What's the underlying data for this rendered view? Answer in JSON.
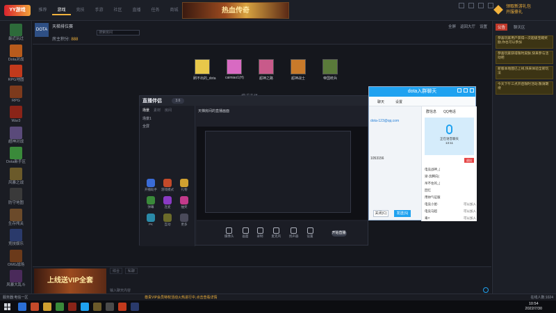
{
  "topbar": {
    "logo": "YY游戏",
    "tabs": [
      "推荐",
      "游戏",
      "竞技",
      "手游",
      "社区",
      "直播",
      "任务",
      "商城"
    ],
    "active_tab": 1,
    "banner_text": "热血传奇",
    "gold_text_1": "领取新游礼包",
    "gold_text_2": "开服豪礼"
  },
  "sidebar": {
    "items": [
      {
        "label": "最近玩过",
        "color": "#2d6b3a"
      },
      {
        "label": "Dota对战",
        "color": "#b85b1c"
      },
      {
        "label": "RPG地图",
        "color": "#c23a1c"
      },
      {
        "label": "RPG",
        "color": "#7d3a1c"
      },
      {
        "label": "War3",
        "color": "#8a2418"
      },
      {
        "label": "超神对战",
        "color": "#5a4a7a"
      },
      {
        "label": "Dota新手区",
        "color": "#3a8a3a"
      },
      {
        "label": "风暴之战",
        "color": "#6b5a2a"
      },
      {
        "label": "防守地图",
        "color": "#3a3a3a"
      },
      {
        "label": "生存闯关",
        "color": "#6b4a2a"
      },
      {
        "label": "竞技娱乐",
        "color": "#2a3a6b"
      },
      {
        "label": "OMG战场",
        "color": "#6b3a1a"
      },
      {
        "label": "风暴大乱斗",
        "color": "#4a2a5a"
      }
    ]
  },
  "room": {
    "icon_label": "DOTA",
    "title": "天梯排位赛",
    "search_placeholder": "搜索房间",
    "owner_label": "房主积分:",
    "owner_value": "888",
    "buttons": [
      "全屏",
      "返回大厅",
      "设置"
    ]
  },
  "games": [
    {
      "label": "刷不出的_dota",
      "color": "#e8c84a"
    },
    {
      "label": "caimiao1(H)",
      "color": "#d86ac2"
    },
    {
      "label": "超神之路",
      "color": "#c85a8a"
    },
    {
      "label": "超神战士",
      "color": "#c87a2a"
    },
    {
      "label": "帝国统兵",
      "color": "#5a7a3a"
    }
  ],
  "mode_text": "模式选择",
  "livewin": {
    "logo": "直播伴侣",
    "version": "3.6",
    "tabs": [
      "场景",
      "素材",
      "房间"
    ],
    "scenes": [
      "场景1",
      "全屏"
    ],
    "preview_title": "天梯房间的直播画面",
    "tools": [
      "开播助手",
      "游戏模式",
      "礼物",
      "弹幕",
      "连麦",
      "抽奖",
      "PK",
      "互动",
      "更多"
    ],
    "bottom_buttons": [
      "摄像头",
      "画面",
      "录制",
      "麦克风",
      "扬声器",
      "设置"
    ],
    "start_label": "开始直播"
  },
  "qq": {
    "title": "dota入群聊天",
    "sub_tabs": [
      "聊天",
      "设置"
    ],
    "link": "dota-123@qq.com",
    "number": "1053156",
    "close_label": "关闭(C)",
    "send_label": "发送(S)",
    "right_tabs": [
      "群信息",
      "QQ电话"
    ],
    "voice_label": "正在语音聊天",
    "voice_time": "13:11",
    "exit_label": "退出",
    "members": [
      {
        "name": "电竞战神_(",
        "status": ""
      },
      {
        "name": "梁-奔腾向(",
        "status": ""
      },
      {
        "name": "吊不住的_(",
        "status": ""
      },
      {
        "name": "回忆",
        "status": ""
      },
      {
        "name": "用帅气征服",
        "status": ""
      },
      {
        "name": "电竞小屋-",
        "status": "可以加入"
      },
      {
        "name": "电竞马超",
        "status": "可以加入"
      },
      {
        "name": "毒Y",
        "status": "可以加入"
      }
    ]
  },
  "rpanel": {
    "tabs": [
      "公告",
      "聊天区"
    ],
    "active_tab": 0,
    "notices": [
      "恭喜玩家用户获得一次超级宝箱奖励,你也可以参加",
      "恭喜玩家获得限时皮肤,快来参与活动吧",
      "新版本地图已上线,快来体验全新玩法",
      "今天下午三点开启限时活动,敬请期待"
    ]
  },
  "bottom": {
    "ad_text": "上线送VIP全套",
    "chat_tabs": [
      "综合",
      "私聊"
    ],
    "input_label": "输入聊天内容"
  },
  "status": {
    "left": "服务器:电信一区",
    "mid": "尊贵VIP会员特权活动火热进行中,点击查看详情",
    "right": "在线人数:1024"
  },
  "taskbar": {
    "time": "10:54",
    "date": "2022/7/30",
    "icons": [
      "#2b6fd6",
      "#c44a2a",
      "#d0a030",
      "#3a8a3a",
      "#8a2418",
      "#1fa2f0",
      "#6b5a2a",
      "#4a4a4a",
      "#c23a1c",
      "#2a3a6b"
    ]
  }
}
